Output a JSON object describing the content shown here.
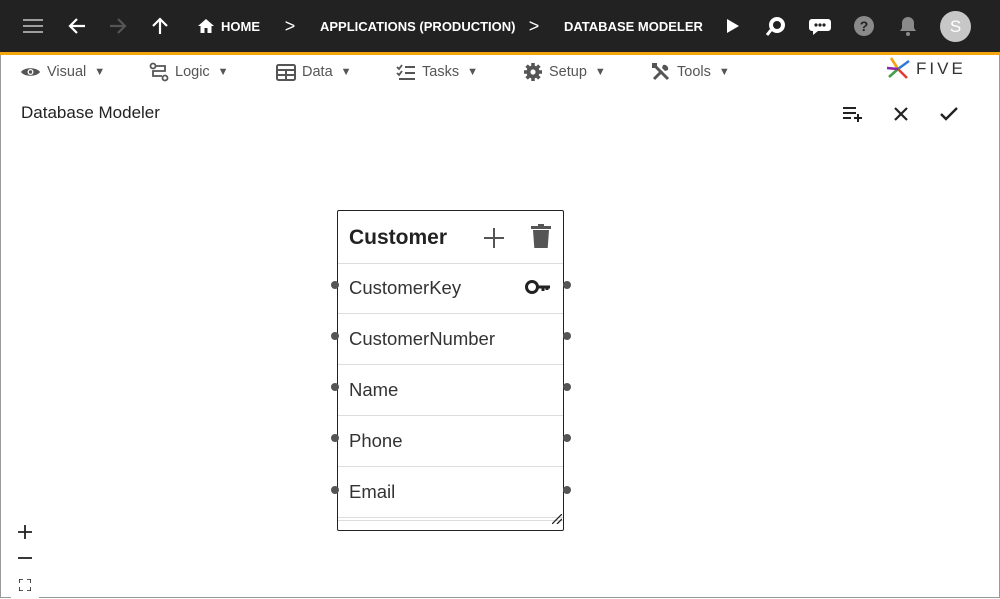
{
  "topbar": {
    "breadcrumbs": [
      "HOME",
      "APPLICATIONS (PRODUCTION)",
      "DATABASE MODELER"
    ],
    "separator": ">",
    "avatar_initial": "S",
    "icons": [
      "menu-icon",
      "back-arrow-icon",
      "forward-arrow-icon",
      "up-arrow-icon",
      "home-icon",
      "play-icon",
      "search-chat-icon",
      "chat-bot-icon",
      "help-icon",
      "bell-icon"
    ]
  },
  "menubar": {
    "items": [
      {
        "label": "Visual",
        "icon": "eye-icon"
      },
      {
        "label": "Logic",
        "icon": "logic-flow-icon"
      },
      {
        "label": "Data",
        "icon": "table-icon"
      },
      {
        "label": "Tasks",
        "icon": "checklist-icon"
      },
      {
        "label": "Setup",
        "icon": "gear-icon"
      },
      {
        "label": "Tools",
        "icon": "tools-icon"
      }
    ],
    "dropdown_glyph": "▼",
    "logo_text": "FIVE"
  },
  "page": {
    "title": "Database Modeler",
    "actions": [
      "add-to-list-icon",
      "close-icon",
      "check-icon"
    ]
  },
  "entity": {
    "name": "Customer",
    "fields": [
      {
        "name": "CustomerKey",
        "primary_key": true
      },
      {
        "name": "CustomerNumber",
        "primary_key": false
      },
      {
        "name": "Name",
        "primary_key": false
      },
      {
        "name": "Phone",
        "primary_key": false
      },
      {
        "name": "Email",
        "primary_key": false
      }
    ]
  },
  "zoom": {
    "in": "+",
    "out": "−"
  },
  "colors": {
    "topbar": "#222222",
    "accent": "#f4a50b",
    "icon_gray": "#555555"
  }
}
